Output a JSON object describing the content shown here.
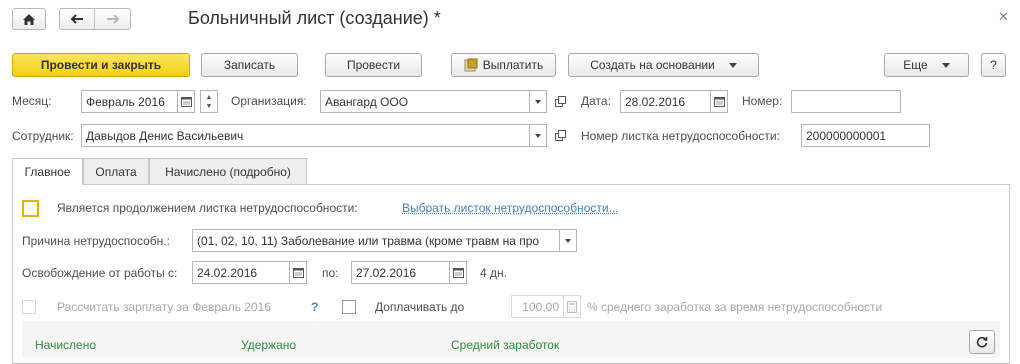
{
  "window": {
    "title": "Больничный лист (создание) *"
  },
  "toolbar": {
    "post_close": "Провести и закрыть",
    "save": "Записать",
    "post": "Провести",
    "pay": "Выплатить",
    "create_based": "Создать на основании",
    "more": "Еще",
    "help": "?"
  },
  "header": {
    "month_label": "Месяц:",
    "month_value": "Февраль 2016",
    "org_label": "Организация:",
    "org_value": "Авангард ООО",
    "date_label": "Дата:",
    "date_value": "28.02.2016",
    "number_label": "Номер:",
    "number_value": "",
    "employee_label": "Сотрудник:",
    "employee_value": "Давыдов Денис Васильевич",
    "sheet_number_label": "Номер листка нетрудоспособности:",
    "sheet_number_value": "200000000001"
  },
  "tabs": [
    {
      "label": "Главное"
    },
    {
      "label": "Оплата"
    },
    {
      "label": "Начислено (подробно)"
    }
  ],
  "main": {
    "continuation_label": "Является продолжением листка нетрудоспособности:",
    "choose_sheet_link": "Выбрать листок нетрудоспособности...",
    "reason_label": "Причина нетрудоспособн.:",
    "reason_value": "(01, 02, 10, 11) Заболевание или травма (кроме травм на про",
    "release_label": "Освобождение от работы с:",
    "release_from": "24.02.2016",
    "to_label": "по:",
    "release_to": "27.02.2016",
    "days_text": "4 дн.",
    "calc_salary_label": "Рассчитать зарплату за Февраль 2016",
    "help_q": "?",
    "pay_extra_label": "Доплачивать до",
    "percent_value": "100,00",
    "percent_suffix": "% среднего заработка за время нетрудоспособности",
    "accrued_header": "Начислено",
    "withheld_header": "Удержано",
    "avg_earnings_header": "Средний заработок"
  },
  "colors": {
    "primary": "#f2cf17",
    "link": "#4a7fb5",
    "green": "#2f8a3d"
  }
}
